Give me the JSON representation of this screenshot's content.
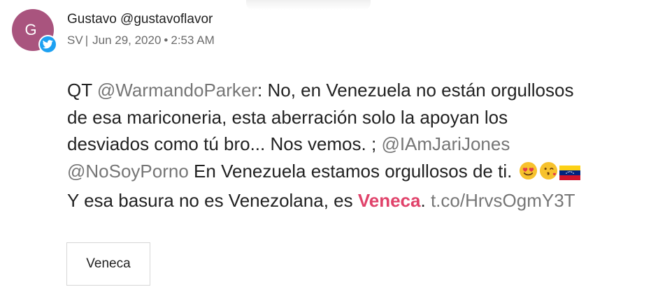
{
  "post": {
    "avatar_initial": "G",
    "source_icon": "twitter-bird-icon",
    "author_name": "Gustavo",
    "author_handle": "@gustavoflavor",
    "location": "SV",
    "separator": "|",
    "date": "Jun 29, 2020",
    "time": "2:53 AM"
  },
  "tweet": {
    "qt_prefix": "QT",
    "mention_1": "@WarmandoParker",
    "text_1": ": No, en Venezuela no están orgullosos",
    "text_2": "de esa mariconeria, esta aberración solo la apoyan los",
    "text_3": "desviados como tú bro... Nos vemos. ;",
    "mention_2": "@IAmJariJones",
    "mention_3": "@NoSoyPorno",
    "text_4": "En Venezuela estamos orgullosos de ti.",
    "emojis": [
      "heart-eyes-emoji",
      "kissing-face-emoji",
      "venezuela-flag-emoji"
    ],
    "text_5": "Y esa basura no es Venezolana, es",
    "highlight_word": "Veneca",
    "text_6": ".",
    "link": "t.co/HrvsOgmY3T"
  },
  "tags": {
    "chip_label": "Veneca"
  },
  "colors": {
    "avatar_bg": "#a9547e",
    "twitter_blue": "#1da1f2",
    "highlight": "#e0426a",
    "muted_text": "#767676"
  }
}
